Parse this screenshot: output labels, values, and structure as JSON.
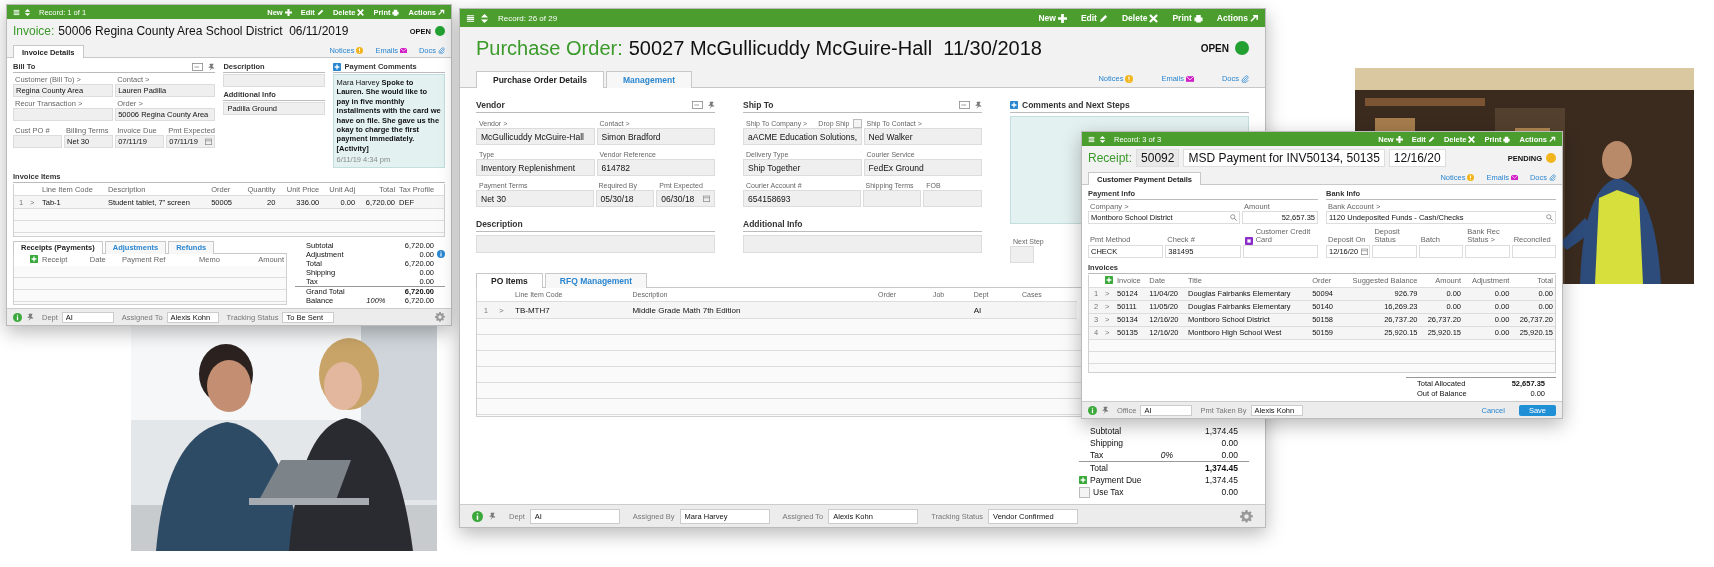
{
  "windows": [
    {
      "record": "Record: 1 of 1",
      "editing": false,
      "toolbar": [
        {
          "label": "New",
          "kind": "plus"
        },
        {
          "label": "Edit",
          "kind": "pencil"
        },
        {
          "label": "Delete",
          "kind": "cross"
        },
        {
          "label": "Print",
          "kind": "printer"
        },
        {
          "label": "Actions",
          "kind": "arrow"
        }
      ],
      "title": {
        "label": "Invoice:",
        "parts": [
          "50006 Regina County Area School District  06/11/2019"
        ]
      },
      "status": {
        "label": "OPEN",
        "color": "#22a032"
      },
      "tabs": [
        {
          "label": "Invoice Details",
          "selected": true
        }
      ],
      "links": [
        {
          "label": "Notices",
          "kind": "notice"
        },
        {
          "label": "Emails",
          "kind": "mail"
        },
        {
          "label": "Docs",
          "kind": "clip"
        }
      ],
      "body": [
        [
          {
            "kind": "columns",
            "columns": [
              [
                {
                  "kind": "fields",
                  "heading": "Bill To",
                  "tools": true,
                  "rows": [
                    [
                      {
                        "label": "Customer (Bill To) >",
                        "value": "Regina County Area"
                      },
                      {
                        "label": "Contact >",
                        "value": "Lauren Padilla"
                      }
                    ],
                    [
                      {
                        "label": "Recur Transaction >"
                      },
                      {
                        "label": "Order >",
                        "value": "50006 Regina County Area"
                      }
                    ]
                  ]
                },
                {
                  "kind": "fields",
                  "rows": [
                    [
                      {
                        "label": "Cust PO #"
                      },
                      {
                        "label": "Billing Terms",
                        "value": "Net 30"
                      },
                      {
                        "label": "Invoice Due",
                        "value": "07/11/19"
                      },
                      {
                        "label": "Pmt Expected",
                        "value": "07/11/19",
                        "kind": "date"
                      }
                    ]
                  ]
                }
              ],
              [
                {
                  "kind": "box",
                  "heading": "Description"
                },
                {
                  "kind": "box",
                  "heading": "Additional Info",
                  "text": "Padilla Ground"
                }
              ],
              [
                {
                  "kind": "comments",
                  "heading": "Payment Comments",
                  "text": "Mara Harvey **Spoke to Lauren. She would like to pay in five monthly installments with the card we have on file. She gave us the okay to charge the first payment immediately. [Activity]**",
                  "time": "6/11/19 4:34 pm"
                }
              ]
            ]
          }
        ],
        [
          {
            "kind": "table",
            "heading": "Invoice Items",
            "add": false,
            "columns": [
              {
                "label": "Line Item Code"
              },
              {
                "label": "Description"
              },
              {
                "label": "Order"
              },
              {
                "label": "Quantity",
                "kind": "number"
              },
              {
                "label": "Unit Price",
                "kind": "number"
              },
              {
                "label": "Unit Adj",
                "kind": "number"
              },
              {
                "label": "Total",
                "kind": "number"
              },
              {
                "label": "Tax Profile"
              }
            ],
            "rows": [
              {
                "num": "1",
                "mark": ">",
                "cells": [
                  "Tab-1",
                  "Student tablet, 7\" screen",
                  "50005",
                  "20",
                  "336.00",
                  "0.00",
                  "6,720.00",
                  "DEF"
                ]
              }
            ]
          }
        ],
        [
          {
            "kind": "table",
            "tabs": [
              {
                "label": "Receipts (Payments)",
                "selected": true
              },
              {
                "label": "Adjustments",
                "selected": false
              },
              {
                "label": "Refunds",
                "selected": false
              }
            ],
            "add": true,
            "columns": [
              {
                "label": "Receipt"
              },
              {
                "label": "Date"
              },
              {
                "label": "Payment Ref"
              },
              {
                "label": "Memo"
              },
              {
                "label": "Amount",
                "kind": "number"
              }
            ]
          },
          {
            "kind": "totals",
            "lines": [
              {
                "label": "Subtotal",
                "value": "6,720.00",
                "bold": false
              },
              {
                "label": "Adjustment",
                "value": "0.00",
                "kind": "info",
                "bold": false
              },
              {
                "label": "Total",
                "value": "6,720.00",
                "bold": false
              },
              {
                "label": "Shipping",
                "value": "0.00",
                "bold": false
              },
              {
                "label": "Tax",
                "value": "0.00",
                "bold": false
              },
              {
                "label": "Grand Total",
                "value": "6,720.00",
                "bold": true
              },
              {
                "label": "Balance",
                "value": "6,720.00",
                "note": "100%",
                "bold": false
              }
            ]
          }
        ]
      ],
      "footer": {
        "fields": [
          {
            "label": "Dept",
            "value": "AI"
          },
          {
            "label": "Assigned To",
            "value": "Alexis Kohn"
          },
          {
            "label": "Tracking Status",
            "value": "To Be Sent"
          }
        ]
      }
    },
    {
      "record": "Record: 26 of 29",
      "editing": false,
      "toolbar": [
        {
          "label": "New",
          "kind": "plus"
        },
        {
          "label": "Edit",
          "kind": "pencil"
        },
        {
          "label": "Delete",
          "kind": "cross"
        },
        {
          "label": "Print",
          "kind": "printer"
        },
        {
          "label": "Actions",
          "kind": "arrow"
        }
      ],
      "title": {
        "label": "Purchase Order:",
        "parts": [
          "50027 McGullicuddy McGuire-Hall  11/30/2018"
        ]
      },
      "status": {
        "label": "OPEN",
        "color": "#22a032"
      },
      "tabs": [
        {
          "label": "Purchase Order Details",
          "selected": true
        },
        {
          "label": "Management",
          "selected": false
        }
      ],
      "links": [
        {
          "label": "Notices",
          "kind": "notice"
        },
        {
          "label": "Emails",
          "kind": "mail"
        },
        {
          "label": "Docs",
          "kind": "clip"
        }
      ],
      "body": [
        [
          {
            "kind": "columns",
            "columns": [
              [
                {
                  "kind": "fields",
                  "heading": "Vendor",
                  "tools": true,
                  "rows": [
                    [
                      {
                        "label": "Vendor >",
                        "value": "McGullicuddy McGuire-Hall"
                      },
                      {
                        "label": "Contact >",
                        "value": "Simon Bradford"
                      }
                    ],
                    [
                      {
                        "label": "Type",
                        "value": "Inventory Replenishment"
                      },
                      {
                        "label": "Vendor Reference",
                        "value": "614782"
                      }
                    ],
                    [
                      {
                        "label": "Payment Terms",
                        "value": "Net 30"
                      },
                      {
                        "label": "Required By",
                        "value": "05/30/18"
                      },
                      {
                        "label": "Pmt Expected",
                        "value": "06/30/18",
                        "kind": "date"
                      }
                    ]
                  ]
                },
                {
                  "kind": "box",
                  "heading": "Description"
                }
              ],
              [
                {
                  "kind": "fields",
                  "heading": "Ship To",
                  "tools": true,
                  "rows": [
                    [
                      {
                        "label": "Ship To Company >",
                        "value": "aACME Education Solutions,",
                        "check_label": "Drop Ship",
                        "checked": false
                      },
                      {
                        "label": "Ship To Contact >",
                        "value": "Ned Walker"
                      }
                    ],
                    [
                      {
                        "label": "Delivery Type",
                        "value": "Ship Together"
                      },
                      {
                        "label": "Courier Service",
                        "value": "FedEx Ground"
                      }
                    ],
                    [
                      {
                        "label": "Courier Account #",
                        "value": "654158693"
                      },
                      {
                        "label": "Shipping Terms"
                      },
                      {
                        "label": "FOB"
                      }
                    ]
                  ]
                },
                {
                  "kind": "box",
                  "heading": "Additional Info"
                }
              ],
              [
                {
                  "kind": "comments",
                  "heading": "Comments and Next Steps"
                },
                {
                  "kind": "fields",
                  "rows": [
                    [
                      {
                        "label": "Next Step"
                      }
                    ]
                  ]
                }
              ]
            ]
          }
        ],
        [
          {
            "kind": "table",
            "tabs": [
              {
                "label": "PO Items",
                "selected": true
              },
              {
                "label": "RFQ Management",
                "selected": false
              }
            ],
            "add": false,
            "columns": [
              {
                "label": "Line Item Code"
              },
              {
                "label": "Description"
              },
              {
                "label": "Order"
              },
              {
                "label": "Job"
              },
              {
                "label": "Dept"
              },
              {
                "label": "Cases"
              }
            ],
            "rows": [
              {
                "num": "1",
                "mark": ">",
                "cells": [
                  "TB-MTH7",
                  "Middle Grade Math 7th Edition",
                  null,
                  null,
                  "AI",
                  null
                ]
              }
            ]
          }
        ],
        [
          {
            "kind": "totals",
            "lines": [
              {
                "label": "Subtotal",
                "value": "1,374.45",
                "bold": false
              },
              {
                "label": "Shipping",
                "value": "0.00",
                "bold": false
              },
              {
                "label": "Tax",
                "note": "0%",
                "value": "0.00",
                "bold": false
              },
              {
                "label": "Total",
                "value": "1,374.45",
                "bold": true
              },
              {
                "label": "Payment Due",
                "value": "1,374.45",
                "kind": "add",
                "bold": false
              },
              {
                "label": "Use Tax",
                "value": "0.00",
                "kind": "check",
                "checked": false,
                "bold": false
              }
            ]
          }
        ]
      ],
      "footer": {
        "fields": [
          {
            "label": "Dept",
            "value": "AI"
          },
          {
            "label": "Assigned By",
            "value": "Mara Harvey"
          },
          {
            "label": "Assigned To",
            "value": "Alexis Kohn"
          },
          {
            "label": "Tracking Status",
            "value": "Vendor Confirmed"
          }
        ]
      }
    },
    {
      "record": "Record: 3 of 3",
      "editing": true,
      "toolbar": [
        {
          "label": "New",
          "kind": "plus"
        },
        {
          "label": "Edit",
          "kind": "pencil"
        },
        {
          "label": "Delete",
          "kind": "cross"
        },
        {
          "label": "Print",
          "kind": "printer"
        },
        {
          "label": "Actions",
          "kind": "arrow"
        }
      ],
      "title": {
        "label": "Receipt:",
        "parts": [
          "50092",
          "MSD Payment for INV50134, 50135",
          "12/16/20"
        ]
      },
      "status": {
        "label": "PENDING",
        "color": "#f2b51c"
      },
      "tabs": [
        {
          "label": "Customer Payment Details",
          "selected": true
        }
      ],
      "links": [
        {
          "label": "Notices",
          "kind": "notice"
        },
        {
          "label": "Emails",
          "kind": "mail"
        },
        {
          "label": "Docs",
          "kind": "clip"
        }
      ],
      "body": [
        [
          {
            "kind": "columns",
            "columns": [
              [
                {
                  "kind": "fields",
                  "heading": "Payment Info",
                  "tools": false,
                  "rows": [
                    [
                      {
                        "label": "Company >",
                        "value": "Montboro School District",
                        "kind": "lookup"
                      },
                      {
                        "label": "Amount",
                        "value": "52,657.35",
                        "kind": "number"
                      }
                    ]
                  ]
                },
                {
                  "kind": "fields",
                  "rows": [
                    [
                      {
                        "label": "Pmt Method",
                        "value": "CHECK"
                      },
                      {
                        "label": "Check #",
                        "value": "381495"
                      },
                      {
                        "label": "Customer Credit Card",
                        "kind": "card"
                      }
                    ]
                  ]
                }
              ],
              [
                {
                  "kind": "fields",
                  "heading": "Bank Info",
                  "tools": false,
                  "rows": [
                    [
                      {
                        "label": "Bank Account >",
                        "value": "1120 Undeposited Funds - Cash/Checks",
                        "kind": "lookup"
                      }
                    ]
                  ]
                },
                {
                  "kind": "fields",
                  "rows": [
                    [
                      {
                        "label": "Deposit On",
                        "value": "12/16/20",
                        "kind": "date"
                      },
                      {
                        "label": "Deposit Status"
                      },
                      {
                        "label": "Batch"
                      },
                      {
                        "label": "Bank Rec Status >"
                      },
                      {
                        "label": "Reconciled"
                      }
                    ]
                  ]
                }
              ]
            ]
          }
        ],
        [
          {
            "kind": "table",
            "heading": "Invoices",
            "add": true,
            "columns": [
              {
                "label": "Invoice"
              },
              {
                "label": "Date"
              },
              {
                "label": "Title"
              },
              {
                "label": "Order"
              },
              {
                "label": "Suggested Balance",
                "kind": "number"
              },
              {
                "label": "Amount",
                "kind": "number"
              },
              {
                "label": "Adjustment",
                "kind": "number"
              },
              {
                "label": "Total",
                "kind": "number"
              }
            ],
            "rows": [
              {
                "num": "1",
                "mark": ">",
                "cells": [
                  "50124",
                  "11/04/20",
                  "Douglas Fairbanks Elementary",
                  "50094",
                  "926.79",
                  "0.00",
                  "0.00",
                  "0.00"
                ]
              },
              {
                "num": "2",
                "mark": ">",
                "cells": [
                  "50111",
                  "11/05/20",
                  "Douglas Fairbanks Elementary",
                  "50140",
                  "16,269.23",
                  "0.00",
                  "0.00",
                  "0.00"
                ]
              },
              {
                "num": "3",
                "mark": ">",
                "cells": [
                  "50134",
                  "12/16/20",
                  "Montboro School District",
                  "50158",
                  "26,737.20",
                  "26,737.20",
                  "0.00",
                  "26,737.20"
                ]
              },
              {
                "num": "4",
                "mark": ">",
                "cells": [
                  "50135",
                  "12/16/20",
                  "Montboro High School West",
                  "50159",
                  "25,920.15",
                  "25,920.15",
                  "0.00",
                  "25,920.15"
                ]
              }
            ]
          }
        ],
        [
          {
            "kind": "totals",
            "lines": [
              {
                "label": "Total Allocated",
                "value": "52,657.35",
                "bold": true
              },
              {
                "label": "Out of Balance",
                "value": "0.00",
                "bold": false
              }
            ]
          }
        ]
      ],
      "footer": {
        "fields": [
          {
            "label": "Office",
            "value": "AI"
          },
          {
            "label": "Pmt Taken By",
            "value": "Alexis Kohn"
          }
        ],
        "buttons": [
          {
            "label": "Cancel",
            "kind": "link"
          },
          {
            "label": "Save",
            "kind": "primary"
          }
        ]
      }
    }
  ]
}
